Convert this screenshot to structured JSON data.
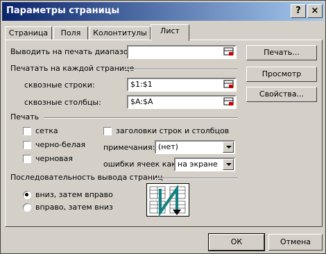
{
  "window": {
    "title": "Параметры страницы",
    "help_glyph": "?",
    "close_glyph": "×"
  },
  "tabs": [
    {
      "label": "Страница"
    },
    {
      "label": "Поля"
    },
    {
      "label": "Колонтитулы"
    },
    {
      "label": "Лист"
    }
  ],
  "print_area": {
    "label": "Выводить на печать диапазон:",
    "value": ""
  },
  "print_titles": {
    "group_label": "Печатать на каждой странице",
    "rows_label": "сквозные строки:",
    "rows_value": "$1:$1",
    "cols_label": "сквозные столбцы:",
    "cols_value": "$A:$A"
  },
  "print": {
    "group_label": "Печать",
    "gridlines": {
      "label": "сетка",
      "checked": false
    },
    "black_white": {
      "label": "черно-белая",
      "checked": false
    },
    "draft": {
      "label": "черновая",
      "checked": false
    },
    "row_col_headings": {
      "label": "заголовки строк и столбцов",
      "checked": false
    },
    "comments_label": "примечания:",
    "comments_value": "(нет)",
    "errors_label": "ошибки ячеек как:",
    "errors_value": "на экране"
  },
  "page_order": {
    "group_label": "Последовательность вывода страниц",
    "down_then_over": {
      "label": "вниз, затем вправо",
      "selected": true
    },
    "over_then_down": {
      "label": "вправо, затем вниз",
      "selected": false
    }
  },
  "buttons": {
    "print": "Печать...",
    "preview": "Просмотр",
    "properties": "Свойства...",
    "ok": "ОК",
    "cancel": "Отмена"
  }
}
